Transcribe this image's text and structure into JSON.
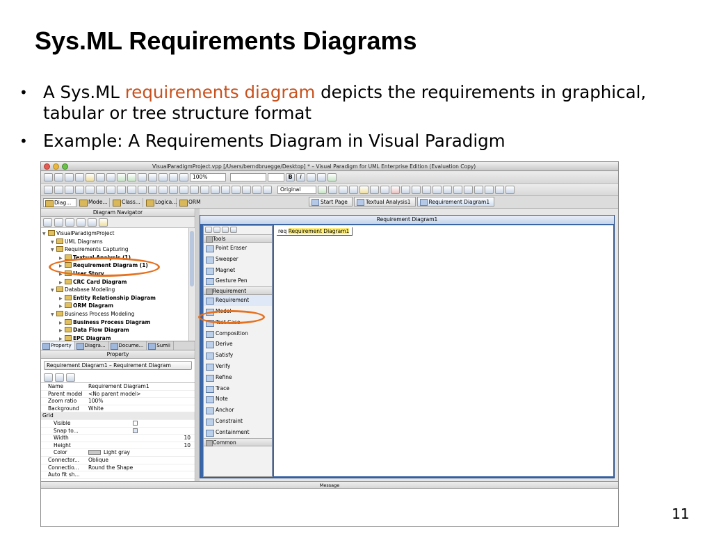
{
  "slide": {
    "title": "Sys.ML Requirements Diagrams",
    "bullet1_pre": "A Sys.ML ",
    "bullet1_hl": "requirements diagram",
    "bullet1_post": " depicts the requirements in graphical, tabular or tree structure format",
    "bullet2": "Example: A Requirements Diagram in Visual Paradigm",
    "page_number": "11",
    "highlight_color": "#c8511d",
    "circle_color": "#e6711f"
  },
  "app": {
    "window_title": "VisualParadigmProject.vpp [/Users/berndbruegge/Desktop] * – Visual Paradigm for UML Enterprise Edition (Evaluation Copy)",
    "zoom_value": "100%",
    "original_value": "Original",
    "left_tabs": [
      "Diag...",
      "Mode...",
      "Class...",
      "Logica...",
      "ORM"
    ],
    "diagram_tabs": [
      "Start Page",
      "Textual Analysis1",
      "Requirement Diagram1"
    ],
    "navigator": {
      "title": "Diagram Navigator",
      "items": [
        {
          "label": "VisualParadigmProject",
          "level": 0,
          "bold": false
        },
        {
          "label": "UML Diagrams",
          "level": 1,
          "bold": false
        },
        {
          "label": "Requirements Capturing",
          "level": 1,
          "bold": false
        },
        {
          "label": "Textual Analysis (1)",
          "level": 2,
          "bold": true
        },
        {
          "label": "Requirement Diagram (1)",
          "level": 2,
          "bold": true
        },
        {
          "label": "User Story",
          "level": 2,
          "bold": true
        },
        {
          "label": "CRC Card Diagram",
          "level": 2,
          "bold": true
        },
        {
          "label": "Database Modeling",
          "level": 1,
          "bold": false
        },
        {
          "label": "Entity Relationship Diagram",
          "level": 2,
          "bold": true
        },
        {
          "label": "ORM Diagram",
          "level": 2,
          "bold": true
        },
        {
          "label": "Business Process Modeling",
          "level": 1,
          "bold": false
        },
        {
          "label": "Business Process Diagram",
          "level": 2,
          "bold": true
        },
        {
          "label": "Data Flow Diagram",
          "level": 2,
          "bold": true
        },
        {
          "label": "EPC Diagram",
          "level": 2,
          "bold": true
        }
      ]
    },
    "bottom_tabs": [
      "Property",
      "Diagra...",
      "Docume...",
      "Sumii"
    ],
    "property": {
      "title": "Property",
      "selector": "Requirement Diagram1 – Requirement Diagram",
      "rows": [
        {
          "key": "Name",
          "value": "Requirement Diagram1",
          "type": "text"
        },
        {
          "key": "Parent model",
          "value": "<No parent model>",
          "type": "text"
        },
        {
          "key": "Zoom ratio",
          "value": "100%",
          "type": "text"
        },
        {
          "key": "Background",
          "value": "White",
          "type": "text"
        },
        {
          "key": "Grid",
          "value": "",
          "type": "group"
        },
        {
          "key": "Visible",
          "value": "",
          "type": "check"
        },
        {
          "key": "Snap to...",
          "value": "",
          "type": "checkon"
        },
        {
          "key": "Width",
          "value": "10",
          "type": "num"
        },
        {
          "key": "Height",
          "value": "10",
          "type": "num"
        },
        {
          "key": "Color",
          "value": "Light gray",
          "type": "color"
        },
        {
          "key": "Connector...",
          "value": "Oblique",
          "type": "text"
        },
        {
          "key": "Connectio...",
          "value": "Round the Shape",
          "type": "text"
        },
        {
          "key": "Auto fit sh...",
          "value": "",
          "type": "text"
        }
      ]
    },
    "diagram": {
      "header": "Requirement Diagram1",
      "frame_prefix": "req",
      "frame_name": "Requirement Diagram1"
    },
    "palette": {
      "sections": [
        {
          "name": "Tools",
          "items": [
            "Point Eraser",
            "Sweeper",
            "Magnet",
            "Gesture Pen"
          ]
        },
        {
          "name": "Requirement",
          "items": [
            "Requirement",
            "Model",
            "Test Case",
            "Composition",
            "Derive",
            "Satisfy",
            "Verify",
            "Refine",
            "Trace",
            "Note",
            "Anchor",
            "Constraint",
            "Containment"
          ]
        },
        {
          "name": "Common",
          "items": []
        }
      ]
    },
    "message_title": "Message"
  }
}
